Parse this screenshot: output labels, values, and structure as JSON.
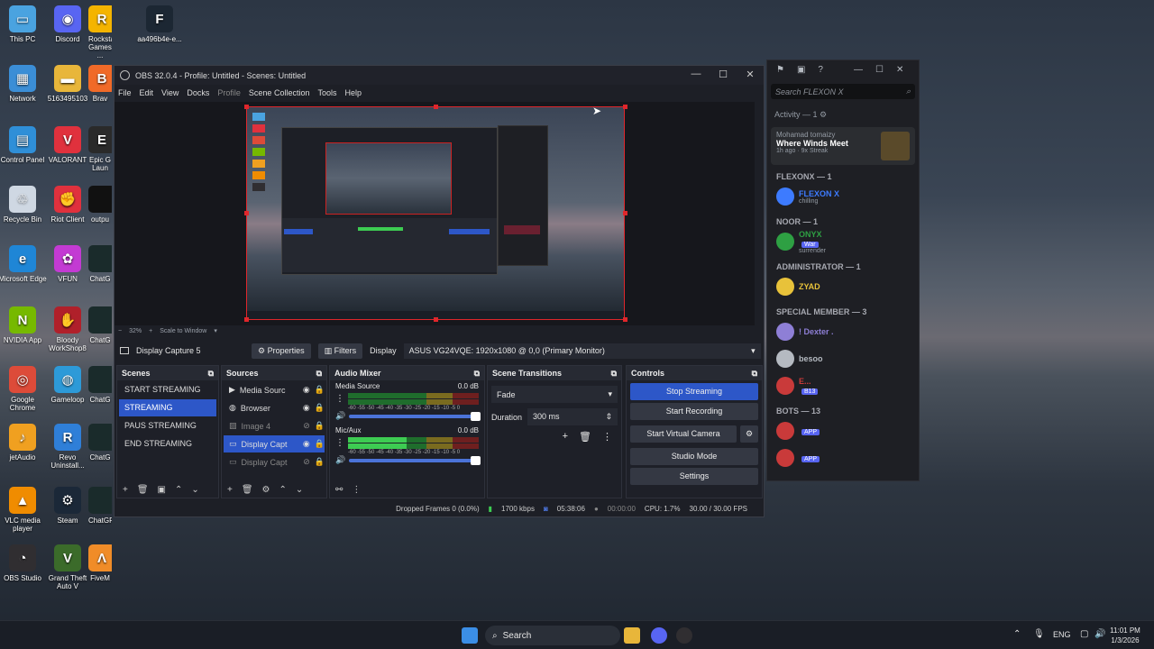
{
  "desktop": {
    "icons": [
      {
        "label": "This PC",
        "color": "#4aa3e0",
        "glyph": "▭"
      },
      {
        "label": "Discord",
        "color": "#5865f2",
        "glyph": "◉"
      },
      {
        "label": "Rockstar Games ...",
        "color": "#f4b400",
        "glyph": "R"
      },
      {
        "label": "aa496b4e-e...",
        "color": "#1c2733",
        "glyph": "F"
      },
      {
        "label": "Network",
        "color": "#3b8ed6",
        "glyph": "▦"
      },
      {
        "label": "5163495103",
        "color": "#e8b63a",
        "glyph": "▬"
      },
      {
        "label": "Brav",
        "color": "#f06a28",
        "glyph": "B"
      },
      {
        "label": "Control Panel",
        "color": "#2f8fd8",
        "glyph": "▤"
      },
      {
        "label": "VALORANT",
        "color": "#e0313d",
        "glyph": "V"
      },
      {
        "label": "Epic G Laun",
        "color": "#2a2a2a",
        "glyph": "E"
      },
      {
        "label": "Recycle Bin",
        "color": "#cfd8e3",
        "glyph": "♲"
      },
      {
        "label": "Riot Client",
        "color": "#e0313d",
        "glyph": "✊"
      },
      {
        "label": "outpu",
        "color": "#111",
        "glyph": ""
      },
      {
        "label": "Microsoft Edge",
        "color": "#1f86d6",
        "glyph": "e"
      },
      {
        "label": "VFUN",
        "color": "#c33ad3",
        "glyph": "✿"
      },
      {
        "label": "ChatG",
        "color": "#1a2b2b",
        "glyph": ""
      },
      {
        "label": "NVIDIA App",
        "color": "#76b900",
        "glyph": "N"
      },
      {
        "label": "Bloody WorkShop8",
        "color": "#b0202a",
        "glyph": "✋"
      },
      {
        "label": "ChatG",
        "color": "#1a2b2b",
        "glyph": ""
      },
      {
        "label": "Google Chrome",
        "color": "#dd4b39",
        "glyph": "◎"
      },
      {
        "label": "Gameloop",
        "color": "#2d9ad8",
        "glyph": "◍"
      },
      {
        "label": "ChatG",
        "color": "#1a2b2b",
        "glyph": ""
      },
      {
        "label": "jetAudio",
        "color": "#f0a020",
        "glyph": "♪"
      },
      {
        "label": "Revo Uninstall...",
        "color": "#2f7fd8",
        "glyph": "R"
      },
      {
        "label": "ChatG",
        "color": "#1a2b2b",
        "glyph": ""
      },
      {
        "label": "VLC media player",
        "color": "#f08c00",
        "glyph": "▲"
      },
      {
        "label": "Steam",
        "color": "#1b2838",
        "glyph": "⚙"
      },
      {
        "label": "ChatGPT_I...",
        "color": "#1a2b2b",
        "glyph": ""
      },
      {
        "label": "OBS Studio",
        "color": "#302e31",
        "glyph": "◔"
      },
      {
        "label": "Grand Theft Auto V",
        "color": "#3b6b2a",
        "glyph": "V"
      },
      {
        "label": "FiveM",
        "color": "#f08c28",
        "glyph": "Λ"
      }
    ]
  },
  "obs": {
    "title": "OBS 32.0.4 - Profile: Untitled - Scenes: Untitled",
    "window_controls": {
      "minimize": "—",
      "maximize": "☐",
      "close": "✕"
    },
    "menu": [
      "File",
      "Edit",
      "View",
      "Docks",
      "Profile",
      "Scene Collection",
      "Tools",
      "Help"
    ],
    "zoom": {
      "minus": "−",
      "value": "32%",
      "plus": "+",
      "mode": "Scale to Window"
    },
    "source_bar": {
      "selected_source": "Display Capture 5",
      "properties_label": "Properties",
      "filters_label": "Filters",
      "display_label": "Display",
      "display_value": "ASUS VG24VQE: 1920x1080 @ 0,0 (Primary Monitor)"
    },
    "scenes": {
      "title": "Scenes",
      "items": [
        "START STREAMING",
        "STREAMING",
        "PAUS STREAMING",
        "END STREAMING"
      ],
      "active_index": 1
    },
    "sources": {
      "title": "Sources",
      "items": [
        "Media Sourc",
        "Browser",
        "Image 4",
        "Display Capt",
        "Display Capt"
      ]
    },
    "audio_mixer": {
      "title": "Audio Mixer",
      "channels": [
        {
          "name": "Media Source",
          "db": "0.0 dB"
        },
        {
          "name": "Mic/Aux",
          "db": "0.0 dB"
        }
      ],
      "scale": "-60 -55 -50 -45 -40 -35 -30 -25 -20 -15 -10 -5 0"
    },
    "transitions": {
      "title": "Scene Transitions",
      "type": "Fade",
      "duration_label": "Duration",
      "duration_value": "300 ms"
    },
    "controls": {
      "title": "Controls",
      "stop_streaming": "Stop Streaming",
      "start_recording": "Start Recording",
      "start_virtual_camera": "Start Virtual Camera",
      "studio_mode": "Studio Mode",
      "settings": "Settings"
    },
    "status": {
      "dropped_frames": "Dropped Frames 0 (0.0%)",
      "bitrate": "1700 kbps",
      "stream_time": "05:38:06",
      "record_time": "00:00:00",
      "cpu": "CPU: 1.7%",
      "fps": "30.00 / 30.00 FPS"
    }
  },
  "discord": {
    "search_placeholder": "Search FLEXON X",
    "activity_header": "Activity — 1",
    "activity": {
      "user": "Mohamad tomaizy",
      "game": "Where Winds Meet",
      "time": "1h ago",
      "streak": "9x Streak"
    },
    "groups": [
      {
        "header": "FLEXONX — 1",
        "members": [
          {
            "name": "FLEXON X",
            "sub": "chilling",
            "color": "#3d7bff"
          }
        ]
      },
      {
        "header": "NOOR — 1",
        "members": [
          {
            "name": "ONYX",
            "tag": "War",
            "sub": "surrender",
            "color": "#2ea043"
          }
        ]
      },
      {
        "header": "ADMINISTRATOR — 1",
        "members": [
          {
            "name": "ZYAD",
            "sub": "",
            "color": "#e8c23a"
          }
        ]
      },
      {
        "header": "SPECIAL MEMBER — 3",
        "members": [
          {
            "name": "! Dexter .",
            "sub": "",
            "color": "#8e7fd6"
          },
          {
            "name": "besoo",
            "sub": "",
            "color": "#b5bac1"
          },
          {
            "name": "E...",
            "tag": "B13",
            "sub": "",
            "color": "#c93a3a"
          }
        ]
      },
      {
        "header": "BOTS — 13",
        "members": [
          {
            "name": "",
            "tag": "APP",
            "sub": "",
            "color": "#c93a3a"
          },
          {
            "name": "",
            "tag": "APP",
            "sub": "",
            "color": "#c93a3a"
          }
        ]
      }
    ]
  },
  "taskbar": {
    "search_label": "Search",
    "language": "ENG",
    "time": "11:01 PM",
    "date": "1/3/2026"
  }
}
